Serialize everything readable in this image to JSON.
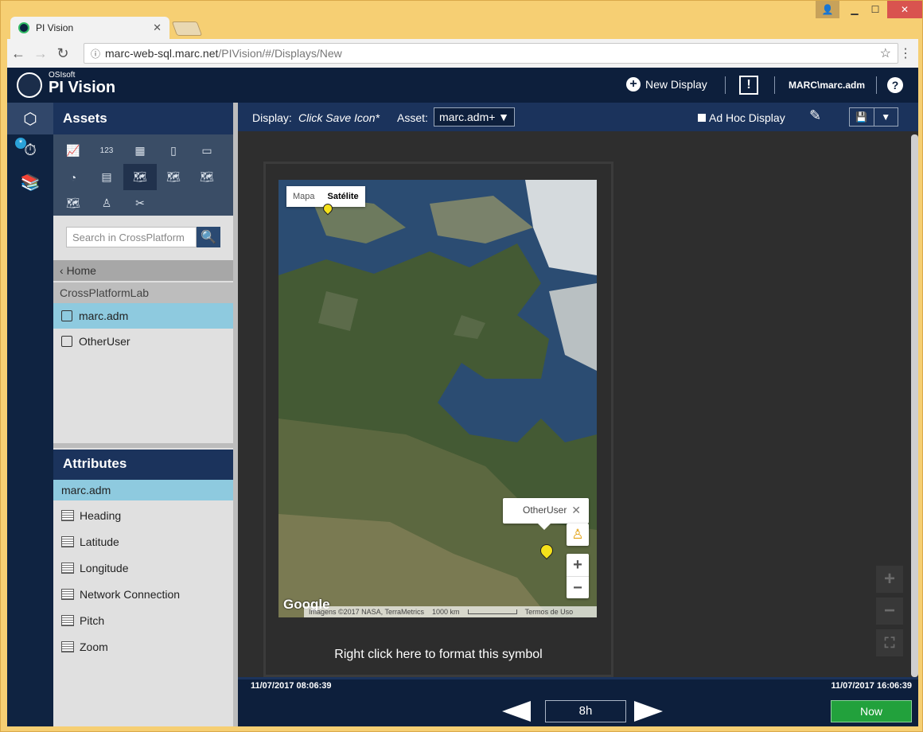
{
  "browser": {
    "tab_title": "PI Vision",
    "url_host": "marc-web-sql.marc.net",
    "url_path": "/PIVision/#/Displays/New"
  },
  "header": {
    "brand_small": "OSIsoft",
    "brand": "PI Vision",
    "new_display": "New Display",
    "alert": "!",
    "user": "MARC\\marc.adm",
    "help": "?"
  },
  "left": {
    "assets_title": "Assets",
    "search_placeholder": "Search in CrossPlatform",
    "home": "Home",
    "folder": "CrossPlatformLab",
    "assets": [
      {
        "label": "marc.adm"
      },
      {
        "label": "OtherUser"
      }
    ],
    "attributes_title": "Attributes",
    "selected_asset": "marc.adm",
    "attributes": [
      {
        "label": "Heading"
      },
      {
        "label": "Latitude"
      },
      {
        "label": "Longitude"
      },
      {
        "label": "Network Connection"
      },
      {
        "label": "Pitch"
      },
      {
        "label": "Zoom"
      }
    ]
  },
  "display_bar": {
    "display_label": "Display:",
    "display_value": "Click Save Icon*",
    "asset_label": "Asset:",
    "asset_value": "marc.adm+",
    "adhoc": "Ad Hoc Display"
  },
  "map": {
    "type_map": "Mapa",
    "type_sat": "Satélite",
    "info_label": "OtherUser",
    "google": "Google",
    "attrib": "Imagens ©2017 NASA, TerraMetrics",
    "scale": "1000 km",
    "terms": "Termos de Uso"
  },
  "symbol_caption": "Right click here to format this symbol",
  "timebar": {
    "start": "11/07/2017 08:06:39",
    "end": "11/07/2017 16:06:39",
    "duration": "8h",
    "now": "Now"
  }
}
